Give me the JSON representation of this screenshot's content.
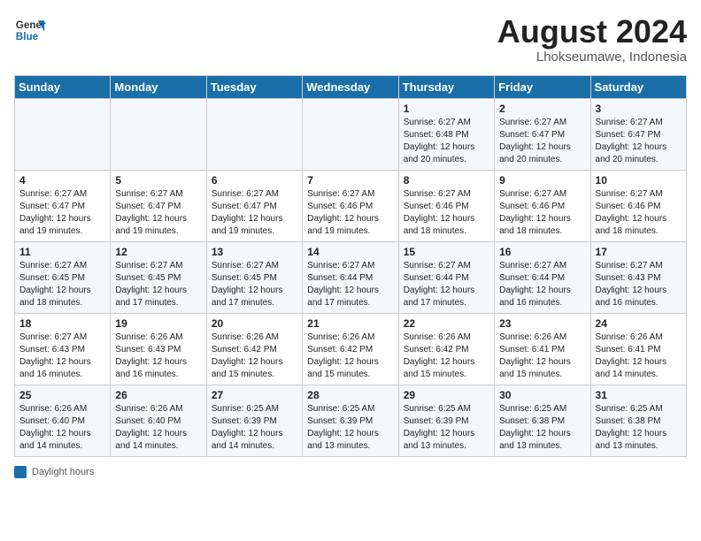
{
  "header": {
    "logo_line1": "General",
    "logo_line2": "Blue",
    "month_year": "August 2024",
    "location": "Lhokseumawe, Indonesia"
  },
  "days_of_week": [
    "Sunday",
    "Monday",
    "Tuesday",
    "Wednesday",
    "Thursday",
    "Friday",
    "Saturday"
  ],
  "footer": {
    "label": "Daylight hours"
  },
  "weeks": [
    [
      {
        "day": "",
        "info": ""
      },
      {
        "day": "",
        "info": ""
      },
      {
        "day": "",
        "info": ""
      },
      {
        "day": "",
        "info": ""
      },
      {
        "day": "1",
        "info": "Sunrise: 6:27 AM\nSunset: 6:48 PM\nDaylight: 12 hours\nand 20 minutes."
      },
      {
        "day": "2",
        "info": "Sunrise: 6:27 AM\nSunset: 6:47 PM\nDaylight: 12 hours\nand 20 minutes."
      },
      {
        "day": "3",
        "info": "Sunrise: 6:27 AM\nSunset: 6:47 PM\nDaylight: 12 hours\nand 20 minutes."
      }
    ],
    [
      {
        "day": "4",
        "info": "Sunrise: 6:27 AM\nSunset: 6:47 PM\nDaylight: 12 hours\nand 19 minutes."
      },
      {
        "day": "5",
        "info": "Sunrise: 6:27 AM\nSunset: 6:47 PM\nDaylight: 12 hours\nand 19 minutes."
      },
      {
        "day": "6",
        "info": "Sunrise: 6:27 AM\nSunset: 6:47 PM\nDaylight: 12 hours\nand 19 minutes."
      },
      {
        "day": "7",
        "info": "Sunrise: 6:27 AM\nSunset: 6:46 PM\nDaylight: 12 hours\nand 19 minutes."
      },
      {
        "day": "8",
        "info": "Sunrise: 6:27 AM\nSunset: 6:46 PM\nDaylight: 12 hours\nand 18 minutes."
      },
      {
        "day": "9",
        "info": "Sunrise: 6:27 AM\nSunset: 6:46 PM\nDaylight: 12 hours\nand 18 minutes."
      },
      {
        "day": "10",
        "info": "Sunrise: 6:27 AM\nSunset: 6:46 PM\nDaylight: 12 hours\nand 18 minutes."
      }
    ],
    [
      {
        "day": "11",
        "info": "Sunrise: 6:27 AM\nSunset: 6:45 PM\nDaylight: 12 hours\nand 18 minutes."
      },
      {
        "day": "12",
        "info": "Sunrise: 6:27 AM\nSunset: 6:45 PM\nDaylight: 12 hours\nand 17 minutes."
      },
      {
        "day": "13",
        "info": "Sunrise: 6:27 AM\nSunset: 6:45 PM\nDaylight: 12 hours\nand 17 minutes."
      },
      {
        "day": "14",
        "info": "Sunrise: 6:27 AM\nSunset: 6:44 PM\nDaylight: 12 hours\nand 17 minutes."
      },
      {
        "day": "15",
        "info": "Sunrise: 6:27 AM\nSunset: 6:44 PM\nDaylight: 12 hours\nand 17 minutes."
      },
      {
        "day": "16",
        "info": "Sunrise: 6:27 AM\nSunset: 6:44 PM\nDaylight: 12 hours\nand 16 minutes."
      },
      {
        "day": "17",
        "info": "Sunrise: 6:27 AM\nSunset: 6:43 PM\nDaylight: 12 hours\nand 16 minutes."
      }
    ],
    [
      {
        "day": "18",
        "info": "Sunrise: 6:27 AM\nSunset: 6:43 PM\nDaylight: 12 hours\nand 16 minutes."
      },
      {
        "day": "19",
        "info": "Sunrise: 6:26 AM\nSunset: 6:43 PM\nDaylight: 12 hours\nand 16 minutes."
      },
      {
        "day": "20",
        "info": "Sunrise: 6:26 AM\nSunset: 6:42 PM\nDaylight: 12 hours\nand 15 minutes."
      },
      {
        "day": "21",
        "info": "Sunrise: 6:26 AM\nSunset: 6:42 PM\nDaylight: 12 hours\nand 15 minutes."
      },
      {
        "day": "22",
        "info": "Sunrise: 6:26 AM\nSunset: 6:42 PM\nDaylight: 12 hours\nand 15 minutes."
      },
      {
        "day": "23",
        "info": "Sunrise: 6:26 AM\nSunset: 6:41 PM\nDaylight: 12 hours\nand 15 minutes."
      },
      {
        "day": "24",
        "info": "Sunrise: 6:26 AM\nSunset: 6:41 PM\nDaylight: 12 hours\nand 14 minutes."
      }
    ],
    [
      {
        "day": "25",
        "info": "Sunrise: 6:26 AM\nSunset: 6:40 PM\nDaylight: 12 hours\nand 14 minutes."
      },
      {
        "day": "26",
        "info": "Sunrise: 6:26 AM\nSunset: 6:40 PM\nDaylight: 12 hours\nand 14 minutes."
      },
      {
        "day": "27",
        "info": "Sunrise: 6:25 AM\nSunset: 6:39 PM\nDaylight: 12 hours\nand 14 minutes."
      },
      {
        "day": "28",
        "info": "Sunrise: 6:25 AM\nSunset: 6:39 PM\nDaylight: 12 hours\nand 13 minutes."
      },
      {
        "day": "29",
        "info": "Sunrise: 6:25 AM\nSunset: 6:39 PM\nDaylight: 12 hours\nand 13 minutes."
      },
      {
        "day": "30",
        "info": "Sunrise: 6:25 AM\nSunset: 6:38 PM\nDaylight: 12 hours\nand 13 minutes."
      },
      {
        "day": "31",
        "info": "Sunrise: 6:25 AM\nSunset: 6:38 PM\nDaylight: 12 hours\nand 13 minutes."
      }
    ]
  ]
}
